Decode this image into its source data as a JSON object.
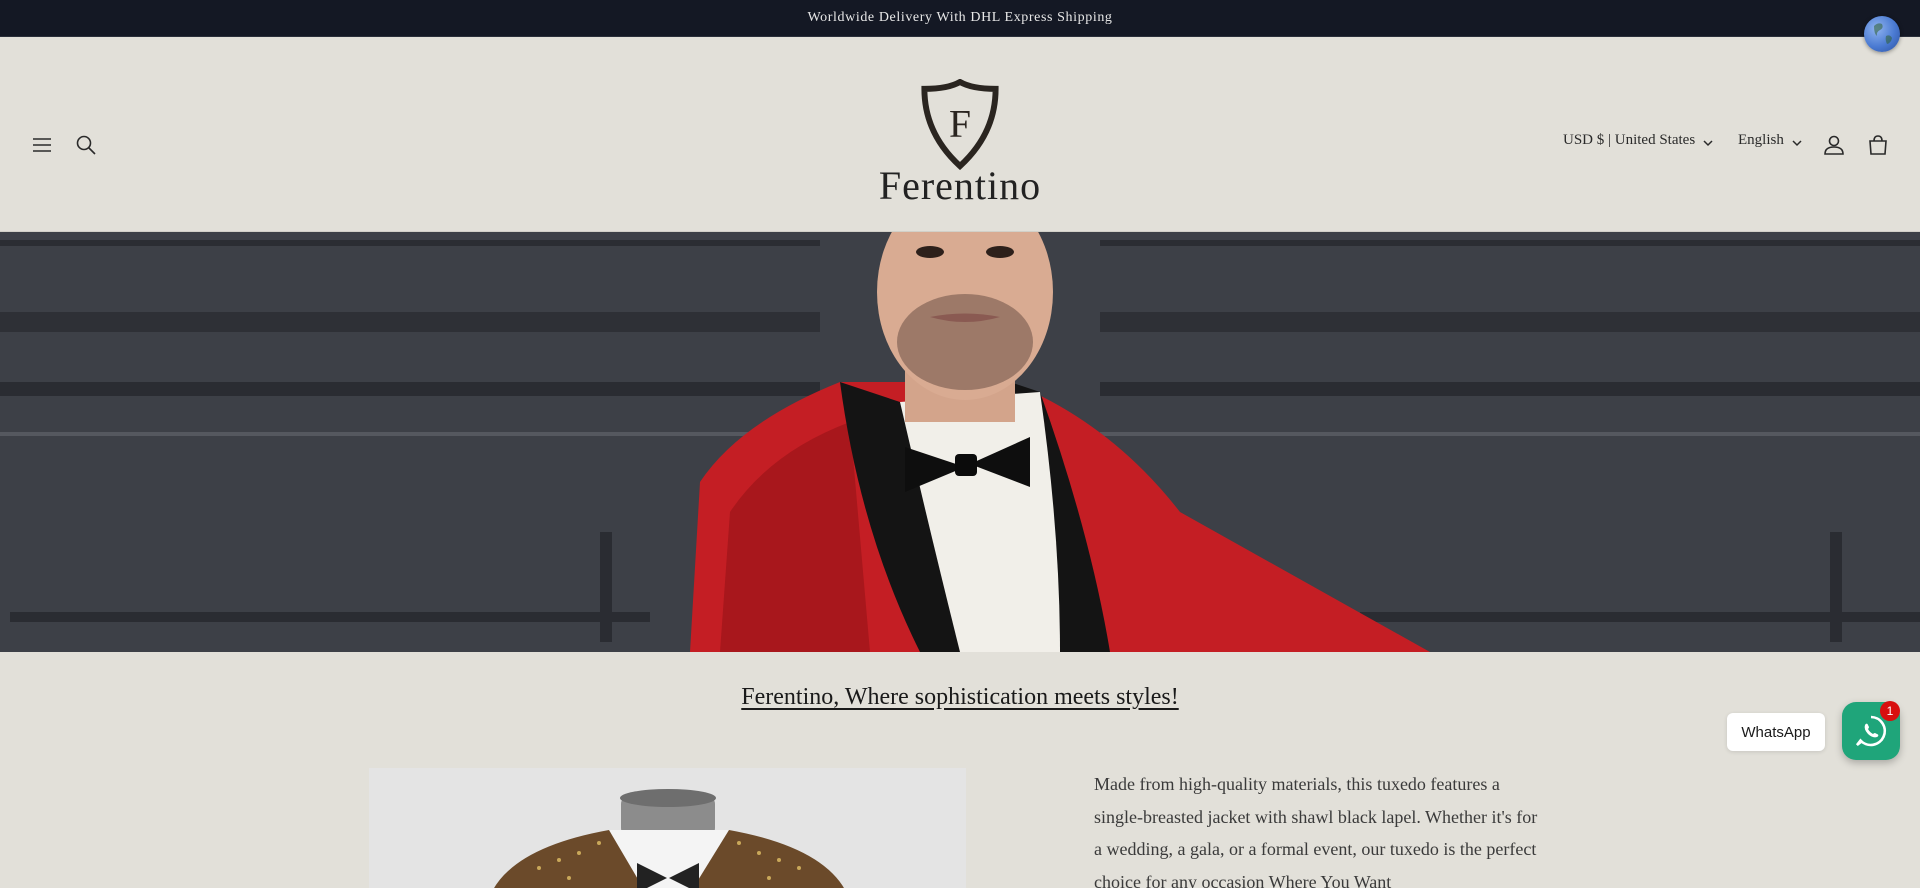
{
  "announcement": {
    "text": "Worldwide Delivery With DHL Express Shipping"
  },
  "header": {
    "logo_letter": "F",
    "logo_word": "Ferentino",
    "currency_selector": "USD $ | United States",
    "language_selector": "English",
    "icons": [
      "hamburger-menu-icon",
      "search-icon",
      "account-icon",
      "cart-icon",
      "globe-icon",
      "chevron-down-icon"
    ]
  },
  "hero": {
    "image": "man-in-red-velvet-tuxedo-with-bow-tie"
  },
  "content": {
    "tagline": "Ferentino, Where sophistication meets styles!",
    "description": "Made from high-quality materials, this tuxedo features a single-breasted jacket with shawl black lapel. Whether it's for a wedding, a gala, or a formal event, our tuxedo is the perfect choice for any occasion Where You Want"
  },
  "whatsapp": {
    "label": "WhatsApp",
    "badge_count": "1",
    "color": "#1fa57a",
    "badge_color": "#d80f0f"
  },
  "colors": {
    "announcement_bg": "#141824",
    "page_bg": "#e2e0d9"
  }
}
